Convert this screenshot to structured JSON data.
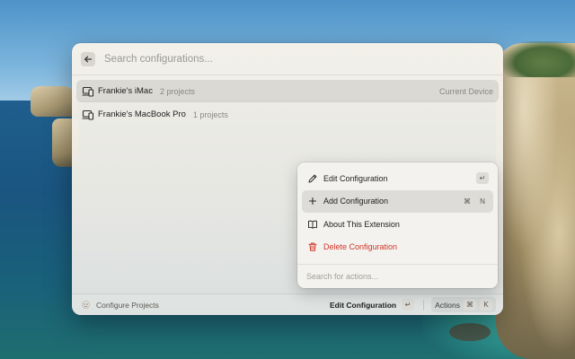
{
  "search": {
    "placeholder": "Search configurations..."
  },
  "list": {
    "items": [
      {
        "title": "Frankie's iMac",
        "subtitle": "2 projects",
        "accessory": "Current Device",
        "icon": "devices-icon",
        "selected": true
      },
      {
        "title": "Frankie's MacBook Pro",
        "subtitle": "1 projects",
        "accessory": "",
        "icon": "devices-icon",
        "selected": false
      }
    ]
  },
  "footer": {
    "extension_name": "Configure Projects",
    "primary_action": "Edit Configuration",
    "primary_shortcut": "↵",
    "actions_label": "Actions",
    "actions_shortcut": [
      "⌘",
      "K"
    ]
  },
  "action_panel": {
    "items": [
      {
        "label": "Edit Configuration",
        "icon": "pencil-icon",
        "shortcut": [
          "↵"
        ],
        "style": "normal",
        "selected": false
      },
      {
        "label": "Add Configuration",
        "icon": "plus-icon",
        "shortcut": [
          "⌘",
          "N"
        ],
        "style": "normal",
        "selected": true
      },
      {
        "label": "About This Extension",
        "icon": "book-icon",
        "shortcut": [],
        "style": "normal",
        "selected": false
      },
      {
        "label": "Delete Configuration",
        "icon": "trash-icon",
        "shortcut": [],
        "style": "destructive",
        "selected": false
      }
    ],
    "search_placeholder": "Search for actions..."
  },
  "colors": {
    "destructive": "#d0362a",
    "selection": "rgba(0,0,0,0.09)"
  }
}
